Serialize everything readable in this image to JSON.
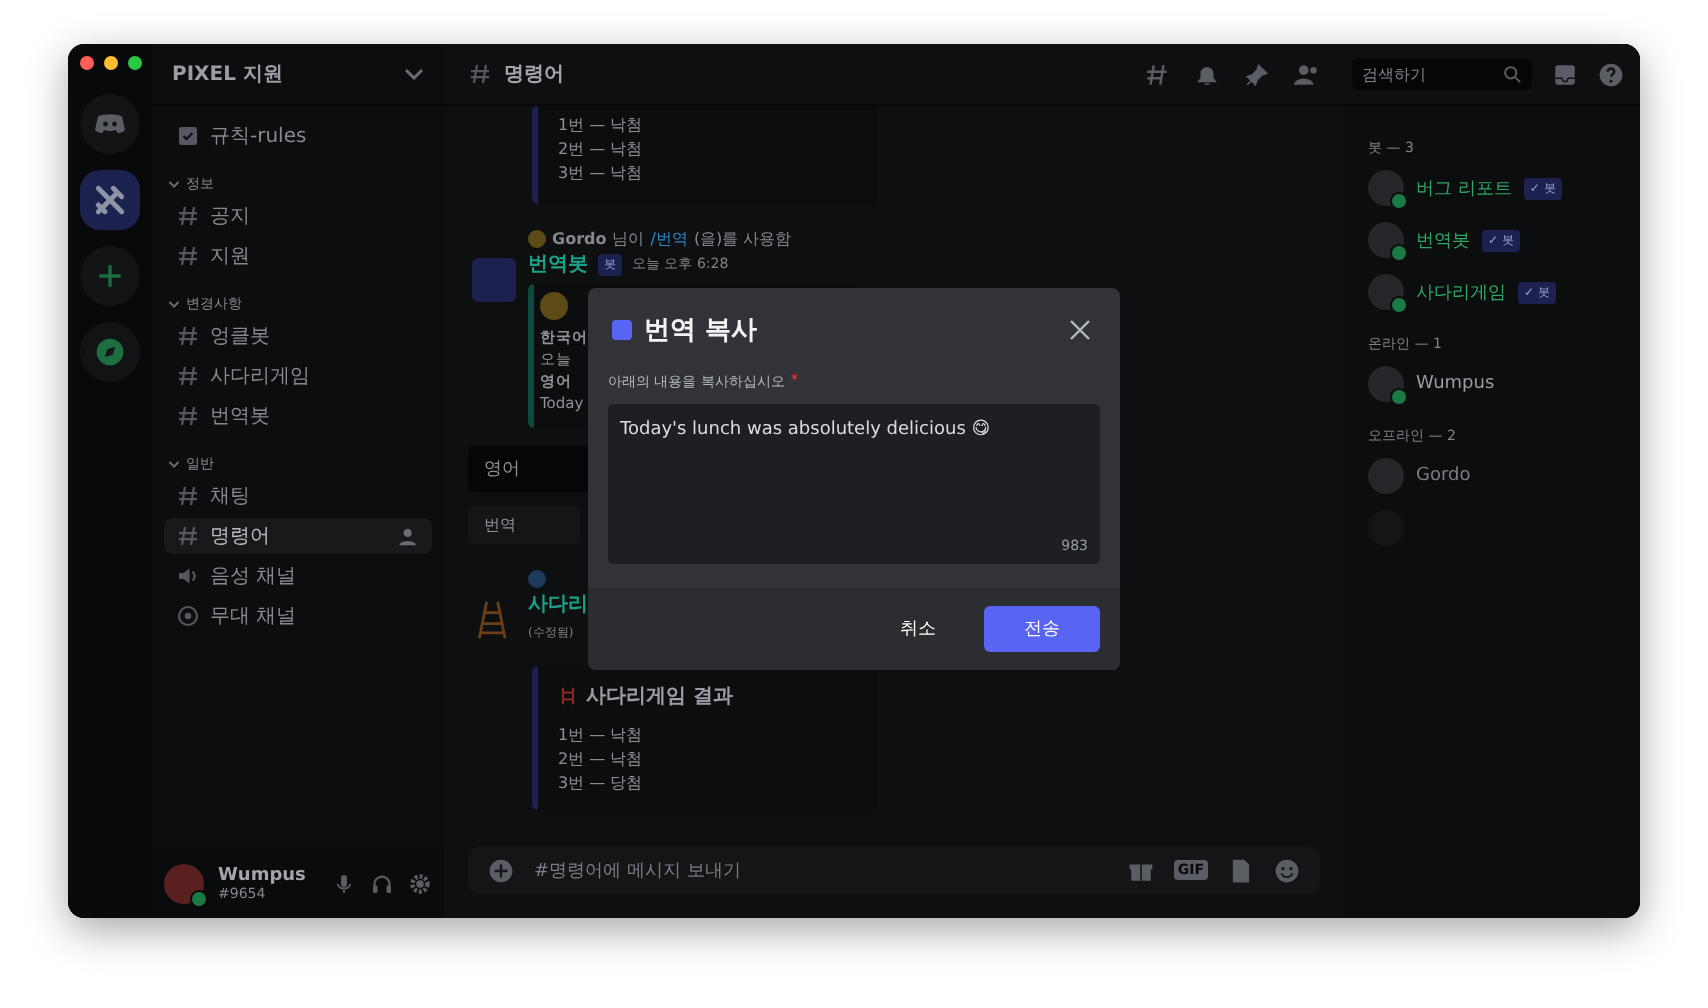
{
  "server_rail": {
    "items": [
      {
        "kind": "home",
        "selected": false
      },
      {
        "kind": "server",
        "selected": true
      },
      {
        "kind": "add",
        "selected": false
      },
      {
        "kind": "explore",
        "selected": false
      }
    ]
  },
  "sidebar": {
    "server_name": "PIXEL 지원",
    "pinned": [
      {
        "kind": "rules",
        "name": "규칙-rules",
        "selected": false
      }
    ],
    "categories": [
      {
        "name": "정보",
        "channels": [
          {
            "kind": "text",
            "name": "공지",
            "selected": false
          },
          {
            "kind": "text",
            "name": "지원",
            "selected": false
          }
        ]
      },
      {
        "name": "변경사항",
        "channels": [
          {
            "kind": "text",
            "name": "엉클봇",
            "selected": false
          },
          {
            "kind": "text",
            "name": "사다리게임",
            "selected": false
          },
          {
            "kind": "text",
            "name": "번역봇",
            "selected": false
          }
        ]
      },
      {
        "name": "일반",
        "channels": [
          {
            "kind": "text",
            "name": "채팅",
            "selected": false
          },
          {
            "kind": "text",
            "name": "명령어",
            "selected": true
          },
          {
            "kind": "voice",
            "name": "음성 채널",
            "selected": false
          },
          {
            "kind": "stage",
            "name": "무대 채널",
            "selected": false
          }
        ]
      }
    ]
  },
  "user_panel": {
    "name": "Wumpus",
    "tag": "#9654"
  },
  "channel_header": {
    "name": "명령어",
    "search_placeholder": "검색하기"
  },
  "messages": [
    {
      "kind": "embed_tail",
      "lines": [
        "1번 — 낙첨",
        "2번 — 낙첨",
        "3번 — 낙첨"
      ]
    },
    {
      "kind": "translate",
      "reply_user": "Gordo",
      "reply_before": "님이",
      "reply_command": "/번역",
      "reply_after": "(을)를 사용함",
      "author": "번역봇",
      "bot_tag": "봇",
      "time": "오늘 오후 6:28",
      "embed_lines": [
        "한국어",
        "오늘",
        "영어",
        "Today"
      ],
      "select": "영어",
      "button": "번역"
    },
    {
      "kind": "ladder",
      "author": "사다리",
      "edited": "(수정됨)",
      "embed_title": "사다리게임 결과",
      "lines": [
        "1번 — 낙첨",
        "2번 — 낙첨",
        "3번 — 당첨"
      ]
    }
  ],
  "composer": {
    "placeholder": "#명령어에 메시지 보내기",
    "gif_label": "GIF"
  },
  "members": {
    "groups": [
      {
        "title": "봇 — 3",
        "members": [
          {
            "name": "버그 리포트",
            "bot_tag": "✓ 봇",
            "online": true,
            "color": "#2fa866"
          },
          {
            "name": "번역봇",
            "bot_tag": "✓ 봇",
            "online": true,
            "color": "#2fa866"
          },
          {
            "name": "사다리게임",
            "bot_tag": "✓ 봇",
            "online": true,
            "color": "#2fa866"
          }
        ]
      },
      {
        "title": "온라인 — 1",
        "members": [
          {
            "name": "Wumpus",
            "online": true,
            "color": "#9a9da4"
          }
        ]
      },
      {
        "title": "오프라인 — 2",
        "members": [
          {
            "name": "Gordo",
            "online": false,
            "color": "#7c7f86"
          }
        ]
      }
    ]
  },
  "modal": {
    "title": "번역 복사",
    "field_label": "아래의 내용을 복사하십시오",
    "required_mark": "*",
    "value": "Today's lunch was absolutely delicious 😋",
    "counter": "983",
    "cancel": "취소",
    "submit": "전송"
  }
}
